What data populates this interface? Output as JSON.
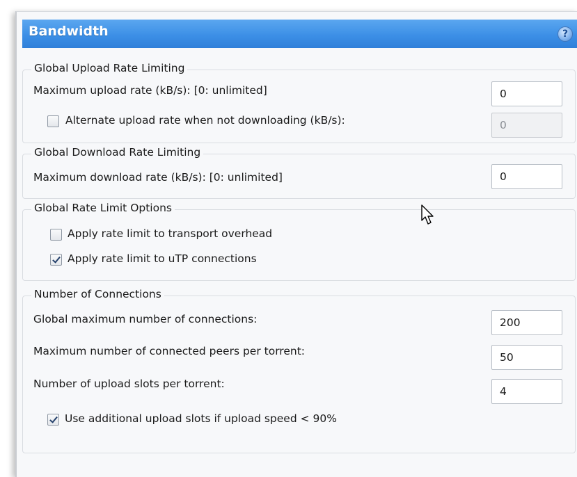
{
  "header": {
    "title": "Bandwidth",
    "help_icon": "?"
  },
  "upload_group": {
    "legend": "Global Upload Rate Limiting",
    "max_upload_label": "Maximum upload rate (kB/s): [0: unlimited]",
    "max_upload_value": "0",
    "alternate_label": "Alternate upload rate when not downloading (kB/s):",
    "alternate_checked": false,
    "alternate_value": "0"
  },
  "download_group": {
    "legend": "Global Download Rate Limiting",
    "max_download_label": "Maximum download rate (kB/s): [0: unlimited]",
    "max_download_value": "0"
  },
  "options_group": {
    "legend": "Global Rate Limit Options",
    "transport_overhead_label": "Apply rate limit to transport overhead",
    "transport_overhead_checked": false,
    "utp_label": "Apply rate limit to uTP connections",
    "utp_checked": true
  },
  "connections_group": {
    "legend": "Number of Connections",
    "global_max_label": "Global maximum number of connections:",
    "global_max_value": "200",
    "peers_label": "Maximum number of connected peers per torrent:",
    "peers_value": "50",
    "slots_label": "Number of upload slots per torrent:",
    "slots_value": "4",
    "additional_slots_label": "Use additional upload slots if upload speed < 90%",
    "additional_slots_checked": true
  },
  "colors": {
    "header_blue": "#3c8fe6",
    "panel_bg": "#f7f8fa"
  },
  "icons": {
    "help": "help-icon",
    "cursor": "mouse-cursor-icon"
  }
}
